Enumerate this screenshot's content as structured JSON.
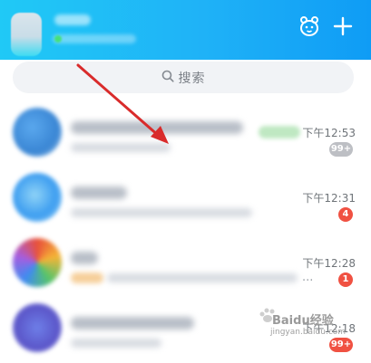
{
  "header": {
    "add_icon": "plus-icon",
    "pet_icon": "pet-face-icon"
  },
  "search": {
    "label": "搜索",
    "icon": "search-icon"
  },
  "chats": [
    {
      "time": "下午12:53",
      "badge": "99+",
      "badge_color": "#bdbfc4"
    },
    {
      "time": "下午12:31",
      "badge": "4",
      "badge_color": "#f05142"
    },
    {
      "time": "下午12:28",
      "badge": "1",
      "badge_color": "#f05142",
      "extra": "..."
    },
    {
      "time": "下午12:18",
      "badge": "99+",
      "badge_color": "#f05142"
    }
  ],
  "watermark": {
    "brand": "Baidu经验",
    "sub": "jingyan.baidu.com"
  },
  "colors": {
    "header_start": "#20c9f6",
    "header_end": "#0f9cf5",
    "annotation_arrow": "#d92b2b"
  }
}
